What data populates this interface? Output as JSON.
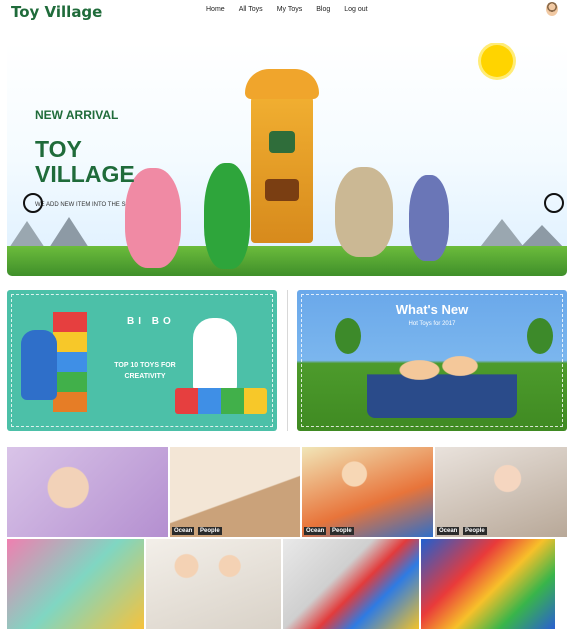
{
  "nav": {
    "brand": "Toy Village",
    "links": [
      "Home",
      "All Toys",
      "My Toys",
      "Blog",
      "Log out"
    ]
  },
  "hero": {
    "kicker": "NEW ARRIVAL",
    "title": "TOY VILLAGE",
    "subtitle": "WE ADD NEW ITEM INTO THE S"
  },
  "promos": [
    {
      "logo": "BI BO",
      "caption": "TOP 10 TOYS FOR CREATIVITY"
    },
    {
      "heading": "What's New",
      "subheading": "Hot Toys for 2017"
    }
  ],
  "gallery": {
    "tags": [
      "Ocean",
      "People"
    ]
  },
  "colors": {
    "brand_green": "#1f6b3a",
    "tag_bg": "#2b2b2b"
  }
}
